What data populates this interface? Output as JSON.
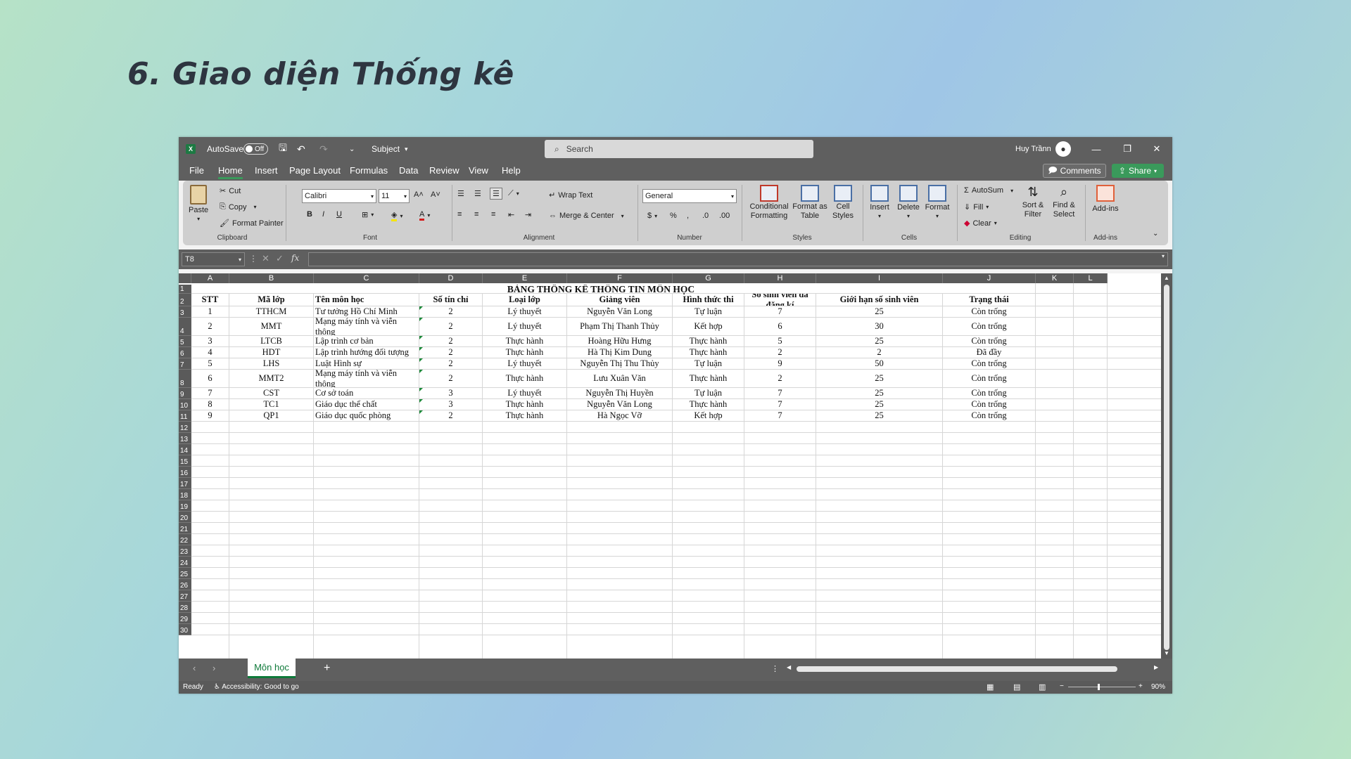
{
  "slide": {
    "title": "6. Giao diện Thống kê"
  },
  "titlebar": {
    "autosave_label": "AutoSave",
    "autosave_state": "Off",
    "filename": "Subject",
    "search_placeholder": "Search",
    "user_name": "Huy Trầnn"
  },
  "menu": {
    "items": [
      "File",
      "Home",
      "Insert",
      "Page Layout",
      "Formulas",
      "Data",
      "Review",
      "View",
      "Help"
    ],
    "active": "Home",
    "comments_label": "Comments",
    "share_label": "Share"
  },
  "ribbon": {
    "clipboard": {
      "paste": "Paste",
      "cut": "Cut",
      "copy": "Copy",
      "format_painter": "Format Painter",
      "group": "Clipboard"
    },
    "font": {
      "name": "Calibri",
      "size": "11",
      "bold": "B",
      "italic": "I",
      "underline": "U",
      "group": "Font"
    },
    "alignment": {
      "wrap_text": "Wrap Text",
      "merge_center": "Merge & Center",
      "group": "Alignment"
    },
    "number": {
      "format": "General",
      "group": "Number"
    },
    "styles": {
      "conditional": "Conditional Formatting",
      "format_table": "Format as Table",
      "cell_styles": "Cell Styles",
      "group": "Styles"
    },
    "cells": {
      "insert": "Insert",
      "delete": "Delete",
      "format": "Format",
      "group": "Cells"
    },
    "editing": {
      "autosum": "AutoSum",
      "fill": "Fill",
      "clear": "Clear",
      "sort_filter": "Sort & Filter",
      "find_select": "Find & Select",
      "group": "Editing"
    },
    "addins": {
      "label": "Add-ins",
      "group": "Add-ins"
    }
  },
  "formula_bar": {
    "name_box": "T8",
    "fx": "fx",
    "value": ""
  },
  "sheet": {
    "columns": [
      "A",
      "B",
      "C",
      "D",
      "E",
      "F",
      "G",
      "H",
      "I",
      "J",
      "K",
      "L"
    ],
    "rows": [
      "1",
      "2",
      "3",
      "4",
      "5",
      "6",
      "7",
      "8",
      "9",
      "10",
      "11",
      "12",
      "13",
      "14",
      "15",
      "16",
      "17",
      "18",
      "19",
      "20",
      "21",
      "22",
      "23",
      "24",
      "25",
      "26",
      "27",
      "28",
      "29",
      "30"
    ],
    "title": "BẢNG THỐNG KÊ THÔNG TIN MÔN HỌC",
    "headers": [
      "STT",
      "Mã lớp",
      "Tên môn học",
      "Số tín chỉ",
      "Loại lớp",
      "Giảng viên",
      "Hình thức thi",
      "Số sinh viên đã đăng kí",
      "Giới hạn số sinh viên",
      "Trạng thái"
    ],
    "data": [
      [
        "1",
        "TTHCM",
        "Tư tưởng Hồ Chí Minh",
        "2",
        "Lý thuyết",
        "Nguyễn Văn Long",
        "Tự luận",
        "7",
        "25",
        "Còn trống"
      ],
      [
        "2",
        "MMT",
        "Mạng máy tính và viễn thông",
        "2",
        "Lý thuyết",
        "Phạm Thị Thanh Thủy",
        "Kết hợp",
        "6",
        "30",
        "Còn trống"
      ],
      [
        "3",
        "LTCB",
        "Lập trình cơ bản",
        "2",
        "Thực hành",
        "Hoàng Hữu Hưng",
        "Thực hành",
        "5",
        "25",
        "Còn trống"
      ],
      [
        "4",
        "HDT",
        "Lập trình hướng đối tượng",
        "2",
        "Thực hành",
        "Hà Thị Kim Dung",
        "Thực hành",
        "2",
        "2",
        "Đã đầy"
      ],
      [
        "5",
        "LHS",
        "Luật Hình sự",
        "2",
        "Lý thuyết",
        "Nguyễn Thị Thu Thủy",
        "Tự luận",
        "9",
        "50",
        "Còn trống"
      ],
      [
        "6",
        "MMT2",
        "Mạng máy tính và viễn thông",
        "2",
        "Thực hành",
        "Lưu Xuân Văn",
        "Thực hành",
        "2",
        "25",
        "Còn trống"
      ],
      [
        "7",
        "CST",
        "Cơ sở toán",
        "3",
        "Lý thuyết",
        "Nguyễn Thị Huyền",
        "Tự luận",
        "7",
        "25",
        "Còn trống"
      ],
      [
        "8",
        "TC1",
        "Giáo dục thể chất",
        "3",
        "Thực hành",
        "Nguyễn Văn Long",
        "Thực hành",
        "7",
        "25",
        "Còn trống"
      ],
      [
        "9",
        "QP1",
        "Giáo dục quốc phòng",
        "2",
        "Thực hành",
        "Hà Ngọc Vỡ",
        "Kết hợp",
        "7",
        "25",
        "Còn trống"
      ]
    ]
  },
  "sheet_tabs": {
    "active": "Môn học",
    "add": "+"
  },
  "status": {
    "ready": "Ready",
    "accessibility": "Accessibility: Good to go",
    "zoom": "90%"
  }
}
